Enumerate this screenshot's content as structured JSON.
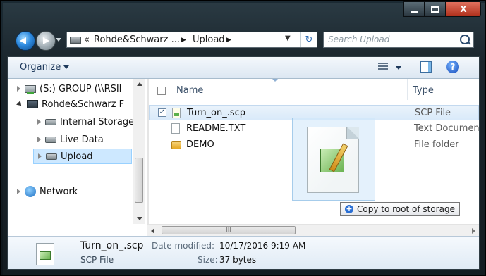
{
  "window": {
    "minimize_label": "",
    "maximize_label": "",
    "close_label": "X"
  },
  "address_bar": {
    "prefix": "«",
    "segments": [
      "Rohde&Schwarz ...",
      "Upload"
    ],
    "separator": "▶",
    "dropdown_glyph": "▼",
    "refresh_glyph": "↻"
  },
  "search": {
    "placeholder": "Search Upload"
  },
  "toolbar": {
    "organize_label": "Organize"
  },
  "help": {
    "glyph": "?"
  },
  "nav_tree": {
    "items": [
      {
        "label": "(S:) GROUP (\\\\RSII",
        "icon": "network-drive-icon",
        "expanded": false,
        "selected": false
      },
      {
        "label": "Rohde&Schwarz F",
        "icon": "device-icon",
        "expanded": true,
        "selected": false
      },
      {
        "label": "Internal Storage",
        "icon": "drive-icon",
        "expanded": false,
        "selected": false
      },
      {
        "label": "Live Data",
        "icon": "drive-icon",
        "expanded": false,
        "selected": false
      },
      {
        "label": "Upload",
        "icon": "drive-icon",
        "expanded": false,
        "selected": true
      },
      {
        "label": "Network",
        "icon": "network-icon",
        "expanded": false,
        "selected": false
      }
    ]
  },
  "file_list": {
    "columns": {
      "name": "Name",
      "type": "Type"
    },
    "rows": [
      {
        "name": "Turn_on_.scp",
        "type": "SCP File",
        "checked": true,
        "icon": "scp-file-icon",
        "selected": true
      },
      {
        "name": "README.TXT",
        "type": "Text Documen",
        "checked": false,
        "icon": "text-file-icon",
        "selected": false
      },
      {
        "name": "DEMO",
        "type": "File folder",
        "checked": false,
        "icon": "folder-icon",
        "selected": false
      }
    ],
    "scroll_thumb_glyph": "III"
  },
  "drag": {
    "tooltip_label": "Copy to root of storage",
    "plus_glyph": "+"
  },
  "details_pane": {
    "file_name": "Turn_on_.scp",
    "file_type": "SCP File",
    "date_modified_label": "Date modified:",
    "date_modified_value": "10/17/2016 9:19 AM",
    "size_label": "Size:",
    "size_value": "37 bytes"
  },
  "check_glyph": "✓"
}
